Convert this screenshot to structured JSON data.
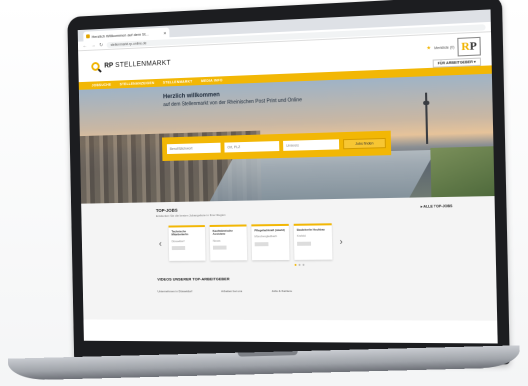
{
  "browser": {
    "tab_title": "Herzlich Willkommen auf dem St...",
    "url": "stellenmarkt.rp-online.de"
  },
  "site": {
    "logo_text_bold": "RP",
    "logo_text": "STELLENMARKT",
    "merkliste": "Merkliste (0)",
    "rp_logo_r": "R",
    "rp_logo_p": "P",
    "arbeitgeber_button": "FÜR ARBEITGEBER  ▾"
  },
  "nav": {
    "items": [
      "JOBSUCHE",
      "STELLENANZEIGEN",
      "STELLENMARKT",
      "MEDIA INFO"
    ]
  },
  "hero": {
    "title": "Herzlich willkommen",
    "subtitle": "auf dem Stellenmarkt von der Rheinischen Post Print und Online",
    "search_keyword_placeholder": "Beruf/Stichwort",
    "search_location_placeholder": "Ort, PLZ",
    "search_radius": "Umkreis",
    "search_button": "Jobs finden"
  },
  "top_jobs": {
    "title": "TOP-JOBS",
    "subtitle": "Entdecken Sie die besten Jobangebote in Ihrer Region",
    "all_link": "▸ ALLE TOP-JOBS",
    "cards": [
      {
        "title": "Technische Mitarbeiter/in",
        "meta": "Düsseldorf"
      },
      {
        "title": "Kaufmännische Assistenz",
        "meta": "Neuss"
      },
      {
        "title": "Pflegefachkraft (m/w/d)",
        "meta": "Mönchengladbach"
      },
      {
        "title": "Bauleiter/in Hochbau",
        "meta": "Krefeld"
      }
    ]
  },
  "videos": {
    "title": "VIDEOS UNSERER TOP-ARBEITGEBER",
    "items": [
      "Unternehmen in Düsseldorf",
      "Arbeiten bei uns",
      "Jobs & Karriere"
    ]
  }
}
